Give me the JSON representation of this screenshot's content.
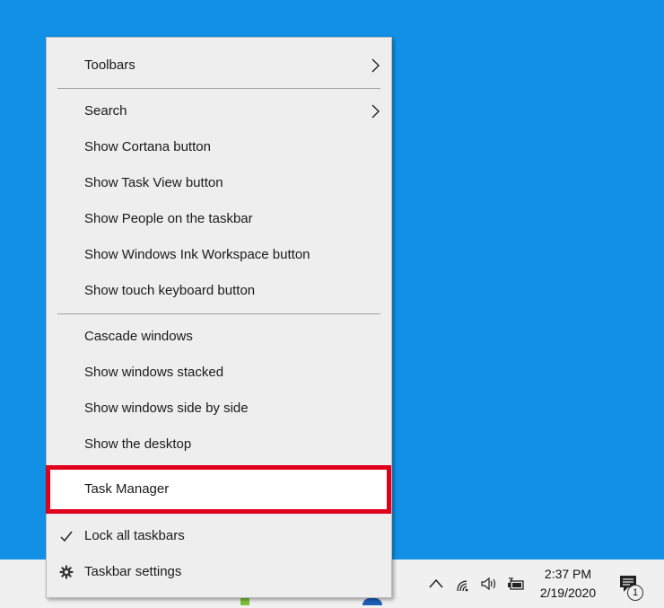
{
  "menu": {
    "items": [
      {
        "label": "Toolbars"
      },
      {
        "label": "Search"
      },
      {
        "label": "Show Cortana button"
      },
      {
        "label": "Show Task View button"
      },
      {
        "label": "Show People on the taskbar"
      },
      {
        "label": "Show Windows Ink Workspace button"
      },
      {
        "label": "Show touch keyboard button"
      },
      {
        "label": "Cascade windows"
      },
      {
        "label": "Show windows stacked"
      },
      {
        "label": "Show windows side by side"
      },
      {
        "label": "Show the desktop"
      },
      {
        "label": "Task Manager",
        "highlighted": true
      },
      {
        "label": "Lock all taskbars",
        "checked": true
      },
      {
        "label": "Taskbar settings",
        "icon": "gear-icon"
      }
    ]
  },
  "taskbar": {
    "clock": {
      "time": "2:37 PM",
      "date": "2/19/2020"
    },
    "notification_count": "1",
    "tray_icons": [
      "chevron-up-icon",
      "network-icon",
      "volume-icon",
      "battery-icon",
      "action-center-icon"
    ]
  },
  "colors": {
    "desktop": "#1190e6",
    "highlight_border": "#e0001b",
    "menu_bg": "#eeeeee"
  }
}
